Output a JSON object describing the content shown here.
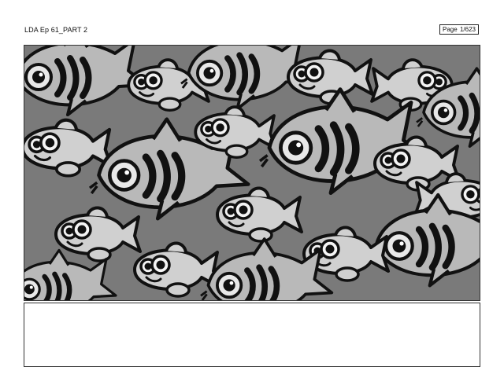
{
  "header": {
    "episode_title": "LDA Ep 61_PART 2",
    "page_label": "Page",
    "page_number": "1/623"
  },
  "panel": {
    "illustration": "fish-pattern-icon"
  },
  "notes": {
    "text": ""
  },
  "colors": {
    "background": "#7a7a7a",
    "fish_light": "#cfcfcf",
    "fish_mid": "#b0b0b0",
    "outline": "#111111"
  }
}
